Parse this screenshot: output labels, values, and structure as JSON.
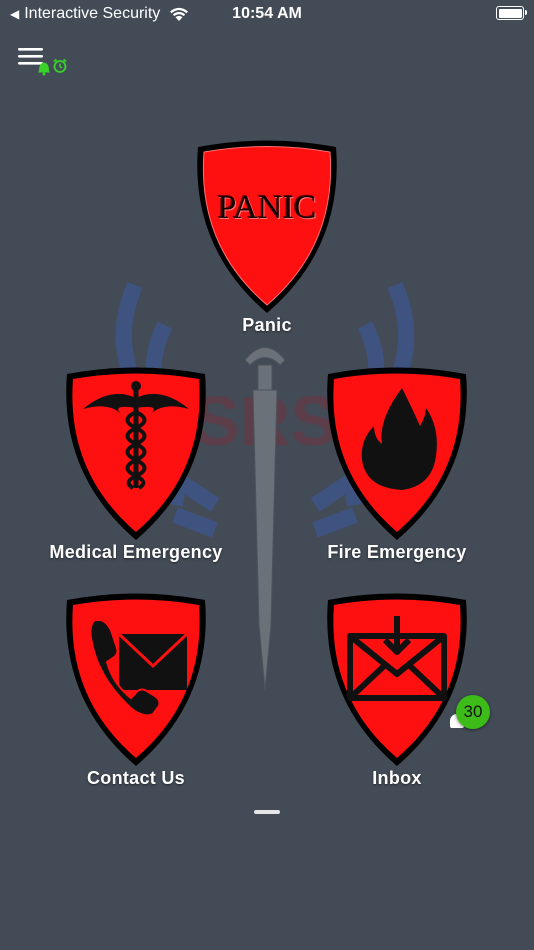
{
  "status_bar": {
    "back_label": "Interactive Security",
    "time": "10:54 AM"
  },
  "icons": {
    "menu": "hamburger-icon",
    "bell": "bell-icon",
    "alarm": "alarm-clock-icon",
    "caduceus": "caduceus-icon",
    "flame": "flame-icon",
    "phone_mail": "phone-envelope-icon",
    "inbox": "envelope-download-icon"
  },
  "colors": {
    "background": "#434b56",
    "shield_red": "#ff1010",
    "badge_green": "#3dbb19",
    "status_green": "#39d12a"
  },
  "tiles": {
    "panic": {
      "label": "Panic",
      "shield_text": "PANIC"
    },
    "medical": {
      "label": "Medical Emergency"
    },
    "fire": {
      "label": "Fire Emergency"
    },
    "contact": {
      "label": "Contact Us"
    },
    "inbox": {
      "label": "Inbox",
      "badge": "30"
    }
  }
}
